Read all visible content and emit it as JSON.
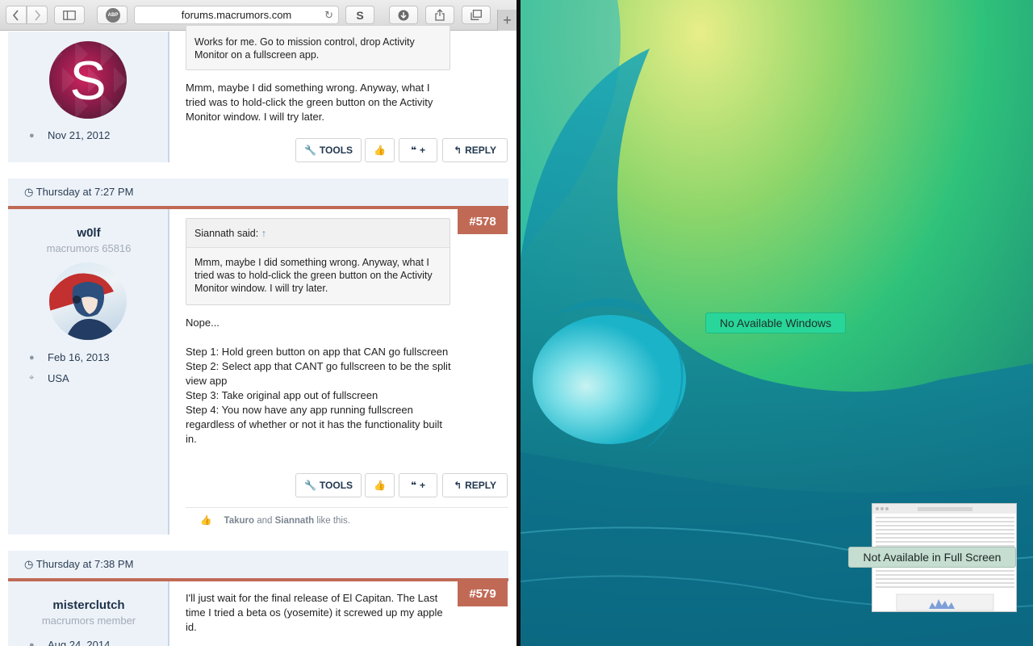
{
  "browser": {
    "url": "forums.macrumors.com",
    "abp_label": "ABP",
    "s_label": "S",
    "new_tab_label": "+"
  },
  "posts": {
    "prev": {
      "quote_text": "Works for me. Go to mission control, drop Activity Monitor on a fullscreen app.",
      "body": "Mmm, maybe I did something wrong. Anyway, what I tried was to hold-click the green button on the Activity Monitor window. I will try later.",
      "joined": "Nov 21, 2012",
      "avatar_letter": "S"
    },
    "p578": {
      "date": "Thursday at 7:27 PM",
      "number": "#578",
      "username": "w0lf",
      "user_title": "macrumors 65816",
      "joined": "Feb 16, 2013",
      "location": "USA",
      "quote_author": "Siannath said:",
      "quote_arrow": "↑",
      "quote_text": "Mmm, maybe I did something wrong. Anyway, what I tried was to hold-click the green button on the Activity Monitor window. I will try later.",
      "body_lines": [
        "Nope...",
        "",
        "Step 1: Hold green button on app that CAN go fullscreen",
        "Step 2: Select app that CANT go fullscreen to be the split view app",
        "Step 3: Take original app out of fullscreen",
        "Step 4: You now have any app running fullscreen regardless of whether or not it has the functionality built in."
      ],
      "likes_user1": "Takuro",
      "likes_and": "and",
      "likes_user2": "Siannath",
      "likes_suffix": "like this."
    },
    "p579": {
      "date": "Thursday at 7:38 PM",
      "number": "#579",
      "username": "misterclutch",
      "user_title": "macrumors member",
      "joined": "Aug 24, 2014",
      "body": "I'll just wait for the final release of El Capitan. The Last time I tried a beta os (yosemite) it screwed up my apple id."
    }
  },
  "actions": {
    "tools": "TOOLS",
    "quote_plus": "+",
    "reply": "REPLY"
  },
  "split_view": {
    "no_windows": "No Available Windows",
    "not_available": "Not Available in Full Screen"
  },
  "icons": [
    "back-icon",
    "forward-icon",
    "sidebar-icon",
    "reload-icon",
    "download-icon",
    "share-icon",
    "tabs-icon",
    "wrench-icon",
    "thumbs-up-icon",
    "quote-icon",
    "reply-icon",
    "user-icon",
    "map-pin-icon",
    "clock-icon"
  ],
  "colors": {
    "accent": "#c06a56",
    "user_col_bg": "#edf2f9",
    "pill_green": "#29d69a"
  }
}
